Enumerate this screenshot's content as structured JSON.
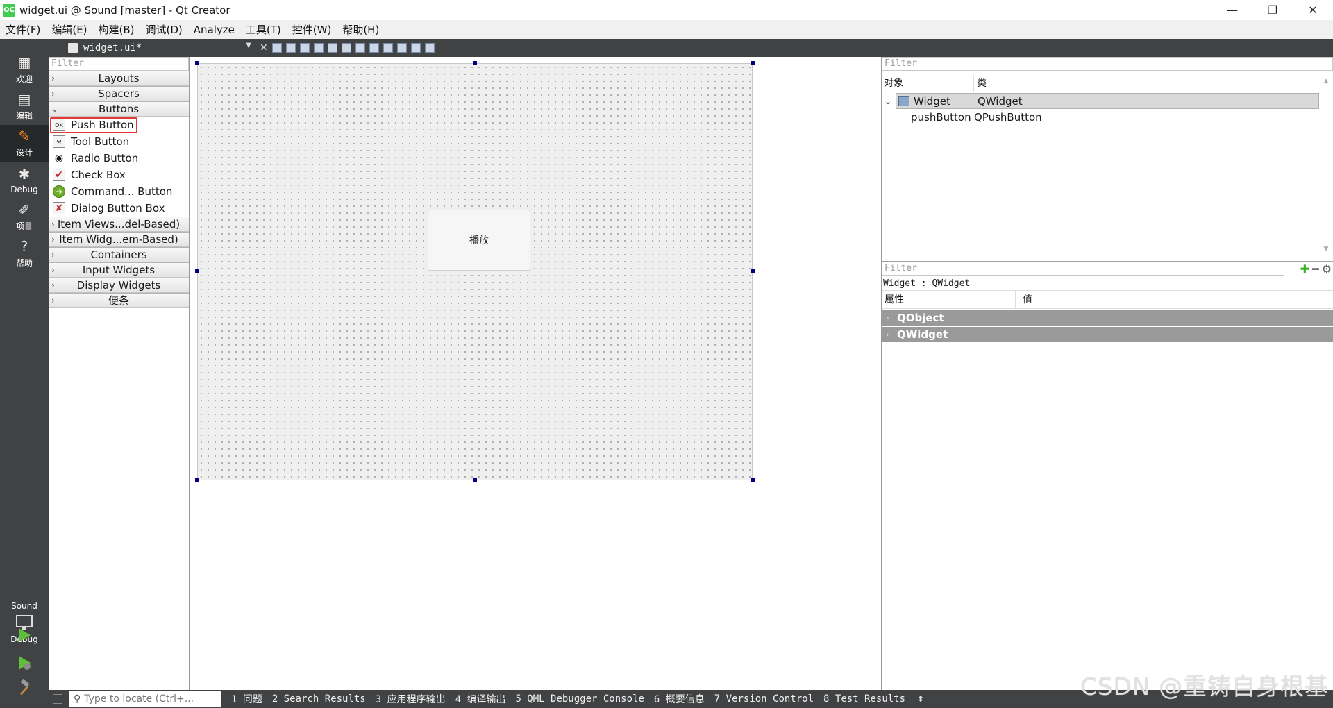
{
  "window": {
    "title": "widget.ui @ Sound [master] - Qt Creator",
    "app_icon": "QC",
    "controls": {
      "minimize": "—",
      "restore": "❐",
      "close": "✕"
    }
  },
  "menu": [
    "文件(F)",
    "编辑(E)",
    "构建(B)",
    "调试(D)",
    "Analyze",
    "工具(T)",
    "控件(W)",
    "帮助(H)"
  ],
  "modes": [
    {
      "label": "欢迎",
      "icon": "grid-icon",
      "glyph": "▦"
    },
    {
      "label": "编辑",
      "icon": "document-icon",
      "glyph": "▤"
    },
    {
      "label": "设计",
      "icon": "pencil-icon",
      "glyph": "✎"
    },
    {
      "label": "Debug",
      "icon": "bug-icon",
      "glyph": "✱"
    },
    {
      "label": "项目",
      "icon": "wrench-icon",
      "glyph": "✐"
    },
    {
      "label": "帮助",
      "icon": "help-icon",
      "glyph": "?"
    }
  ],
  "kit": {
    "project": "Sound",
    "mode": "Debug"
  },
  "editor_toolbar": {
    "document": "widget.ui*"
  },
  "widget_box": {
    "filter_placeholder": "Filter",
    "categories": {
      "layouts": "Layouts",
      "spacers": "Spacers",
      "buttons": "Buttons",
      "item_views": "Item Views...del-Based)",
      "item_widgets": "Item Widg...em-Based)",
      "containers": "Containers",
      "input_widgets": "Input Widgets",
      "display_widgets": "Display Widgets",
      "notes": "便条"
    },
    "button_items": [
      {
        "label": "Push Button",
        "icon": "push-button-icon",
        "glyph": "OK"
      },
      {
        "label": "Tool Button",
        "icon": "tool-button-icon",
        "glyph": "⚒"
      },
      {
        "label": "Radio Button",
        "icon": "radio-button-icon",
        "glyph": "◉"
      },
      {
        "label": "Check Box",
        "icon": "check-box-icon",
        "glyph": "✔"
      },
      {
        "label": "Command... Button",
        "icon": "command-link-icon",
        "glyph": "➜"
      },
      {
        "label": "Dialog Button Box",
        "icon": "dialog-button-box-icon",
        "glyph": "✘"
      }
    ]
  },
  "form": {
    "button_text": "播放"
  },
  "object_inspector": {
    "filter_placeholder": "Filter",
    "headers": {
      "object": "对象",
      "class": "类"
    },
    "rows": [
      {
        "object": "Widget",
        "class": "QWidget"
      },
      {
        "object": "pushButton",
        "class": "QPushButton"
      }
    ]
  },
  "property_editor": {
    "filter_placeholder": "Filter",
    "context": "Widget : QWidget",
    "headers": {
      "property": "属性",
      "value": "值"
    },
    "groups": [
      "QObject",
      "QWidget"
    ]
  },
  "status_bar": {
    "locator_placeholder": "Type to locate (Ctrl+...",
    "panes": [
      "1 问题",
      "2 Search Results",
      "3 应用程序输出",
      "4 编译输出",
      "5 QML Debugger Console",
      "6 概要信息",
      "7 Version Control",
      "8 Test Results"
    ]
  },
  "watermark": "CSDN @重铸自身根基",
  "colors": {
    "dark_panel": "#404244",
    "selection_highlight": "#e53935",
    "handle": "#000080",
    "group_header": "#9a9a9a"
  }
}
